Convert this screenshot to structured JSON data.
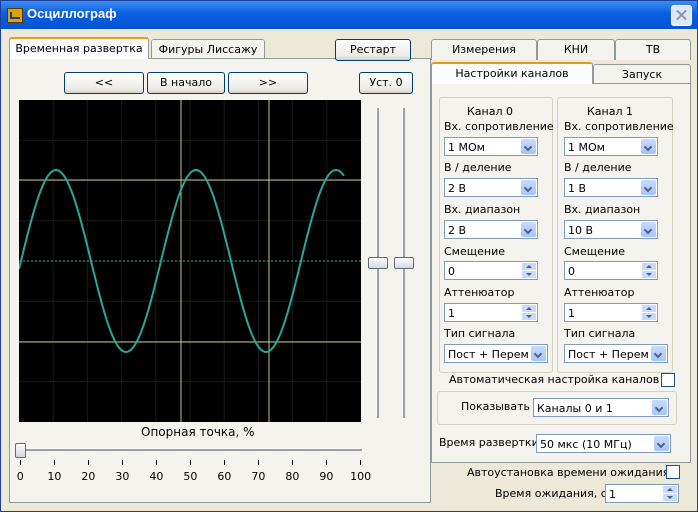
{
  "window": {
    "title": "Осциллограф"
  },
  "left_tabs": [
    "Временная развертка",
    "Фигуры Лиссажу"
  ],
  "buttons": {
    "restart": "Рестарт",
    "prev": "<<",
    "start": "В начало",
    "next": ">>",
    "set_zero": "Уст. 0"
  },
  "scope": {
    "reference_label": "Опорная точка, %",
    "reference_value": 0,
    "axis_ticks": [
      "0",
      "10",
      "20",
      "30",
      "40",
      "50",
      "60",
      "70",
      "80",
      "90",
      "100"
    ]
  },
  "right_tabs": {
    "row1": [
      "Измерения",
      "КНИ",
      "ТВ"
    ],
    "row2": [
      "Настройки каналов",
      "Запуск"
    ]
  },
  "channels": [
    {
      "title": "Канал 0",
      "input_resistance_label": "Вх. сопротивление",
      "input_resistance": "1 МОм",
      "volts_per_div_label": "В / деление",
      "volts_per_div": "2 В",
      "input_range_label": "Вх. диапазон",
      "input_range": "2 В",
      "offset_label": "Смещение",
      "offset": "0",
      "attenuator_label": "Аттенюатор",
      "attenuator": "1",
      "signal_type_label": "Тип сигнала",
      "signal_type": "Пост + Перем"
    },
    {
      "title": "Канал 1",
      "input_resistance_label": "Вх. сопротивление",
      "input_resistance": "1 МОм",
      "volts_per_div_label": "В / деление",
      "volts_per_div": "1 В",
      "input_range_label": "Вх. диапазон",
      "input_range": "10 В",
      "offset_label": "Смещение",
      "offset": "0",
      "attenuator_label": "Аттенюатор",
      "attenuator": "1",
      "signal_type_label": "Тип сигнала",
      "signal_type": "Пост + Перем"
    }
  ],
  "auto_channels": {
    "label": "Автоматическая настройка каналов",
    "checked": false
  },
  "show": {
    "label": "Показывать",
    "value": "Каналы 0 и 1"
  },
  "timebase": {
    "label": "Время развертки",
    "value": "50 мкс (10 МГц)"
  },
  "auto_wait": {
    "label": "Автоустановка времени ожидания",
    "checked": false
  },
  "wait_time": {
    "label": "Время ожидания, с",
    "value": "1"
  },
  "colors": {
    "trace": "#2aa79b",
    "grid": "#c9c58a",
    "scope_bg": "#000000"
  }
}
